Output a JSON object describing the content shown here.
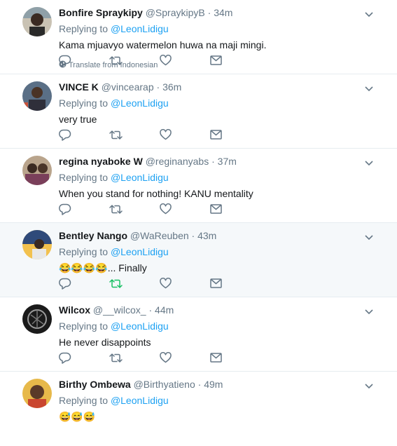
{
  "tweets": [
    {
      "name": "Bonfire Spraykipy",
      "handle": "@SpraykipyB",
      "time": "34m",
      "replying_prefix": "Replying to",
      "replying_to": "@LeonLidigu",
      "text": "Kama mjuavyo watermelon huwa na maji mingi.",
      "translate": "Translate from Indonesian",
      "retweeted": false,
      "highlighted": false
    },
    {
      "name": "VINCE K",
      "handle": "@vincearap",
      "time": "36m",
      "replying_prefix": "Replying to",
      "replying_to": "@LeonLidigu",
      "text": "very true",
      "retweeted": false,
      "highlighted": false
    },
    {
      "name": "regina nyaboke W",
      "handle": "@reginanyabs",
      "time": "37m",
      "replying_prefix": "Replying to",
      "replying_to": "@LeonLidigu",
      "text": "When you stand for nothing! KANU mentality",
      "retweeted": false,
      "highlighted": false
    },
    {
      "name": "Bentley Nango",
      "handle": "@WaReuben",
      "time": "43m",
      "replying_prefix": "Replying to",
      "replying_to": "@LeonLidigu",
      "text": "😂😂😂😂... Finally",
      "retweeted": true,
      "highlighted": true
    },
    {
      "name": "Wilcox",
      "handle": "@__wilcox_",
      "time": "44m",
      "replying_prefix": "Replying to",
      "replying_to": "@LeonLidigu",
      "text": "He never disappoints",
      "retweeted": false,
      "highlighted": false
    },
    {
      "name": "Birthy Ombewa",
      "handle": "@Birthyatieno",
      "time": "49m",
      "replying_prefix": "Replying to",
      "replying_to": "@LeonLidigu",
      "text": "😅😅😅",
      "retweeted": false,
      "highlighted": false
    }
  ],
  "colors": {
    "link": "#1da1f2",
    "muted": "#657786",
    "retweet_active": "#17bf63",
    "highlight_bg": "#f5f8fa"
  },
  "icons": [
    "reply-icon",
    "retweet-icon",
    "like-icon",
    "dm-icon",
    "chevron-down-icon",
    "globe-icon"
  ]
}
